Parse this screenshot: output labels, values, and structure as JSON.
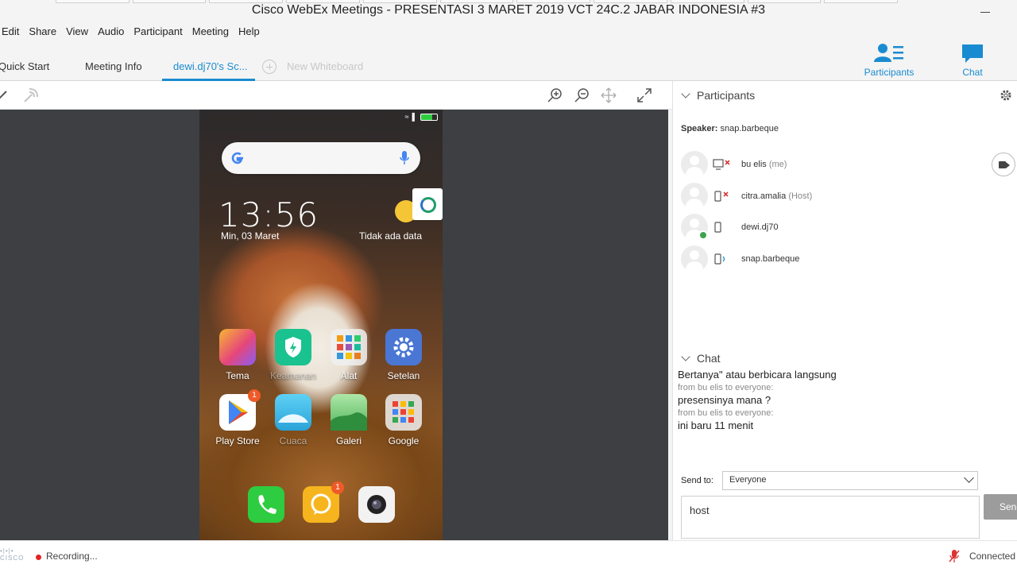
{
  "window": {
    "title": "Cisco WebEx Meetings - PRESENTASI 3 MARET 2019 VCT 24C.2 JABAR INDONESIA #3"
  },
  "menu": [
    "Edit",
    "Share",
    "View",
    "Audio",
    "Participant",
    "Meeting",
    "Help"
  ],
  "tabs": {
    "quick_start": "Quick Start",
    "meeting_info": "Meeting Info",
    "share": "dewi.dj70's Sc...",
    "new_whiteboard": "New Whiteboard"
  },
  "panels": {
    "participants": "Participants",
    "chat": "Chat"
  },
  "phone": {
    "clock": "13:56",
    "date": "Min, 03 Maret",
    "weather": "Tidak ada data",
    "apps": [
      {
        "label": "Tema",
        "color": "#e6477a"
      },
      {
        "label": "Keamanan",
        "color": "#19c28f"
      },
      {
        "label": "Alat",
        "color": "#f0f0f0"
      },
      {
        "label": "Setelan",
        "color": "#4a76d4"
      },
      {
        "label": "Play Store",
        "color": "#ffffff"
      },
      {
        "label": "Cuaca",
        "color": "#3ab4e8"
      },
      {
        "label": "Galeri",
        "color": "#5fc26b"
      },
      {
        "label": "Google",
        "color": "#f0f0f0"
      }
    ],
    "badges": {
      "play_store": "1",
      "messages": "1"
    },
    "dock": [
      "phone-icon",
      "messages-icon",
      "camera-icon"
    ]
  },
  "participants": {
    "header": "Participants",
    "speaker_label": "Speaker:",
    "speaker_name": "snap.barbeque",
    "list": [
      {
        "name": "bu elis",
        "role": "(me)"
      },
      {
        "name": "citra.amalia",
        "role": "(Host)"
      },
      {
        "name": "dewi.dj70",
        "role": ""
      },
      {
        "name": "snap.barbeque",
        "role": ""
      }
    ]
  },
  "chat": {
    "header": "Chat",
    "messages": [
      {
        "type": "text",
        "text": "Bertanya\" atau berbicara langsung"
      },
      {
        "type": "meta",
        "text": "from bu elis to everyone:"
      },
      {
        "type": "text",
        "text": "presensinya mana ?"
      },
      {
        "type": "meta",
        "text": "from bu elis to everyone:"
      },
      {
        "type": "text",
        "text": "ini baru 11 menit"
      }
    ],
    "send_to_label": "Send to:",
    "send_to_value": "Everyone",
    "input_value": "host",
    "send_button": "Send"
  },
  "status": {
    "recording": "Recording...",
    "connection": "Connected",
    "brand": "CISCO"
  },
  "colors": {
    "accent": "#1a8bd0",
    "recording": "#e52222",
    "online": "#3fa34d"
  }
}
